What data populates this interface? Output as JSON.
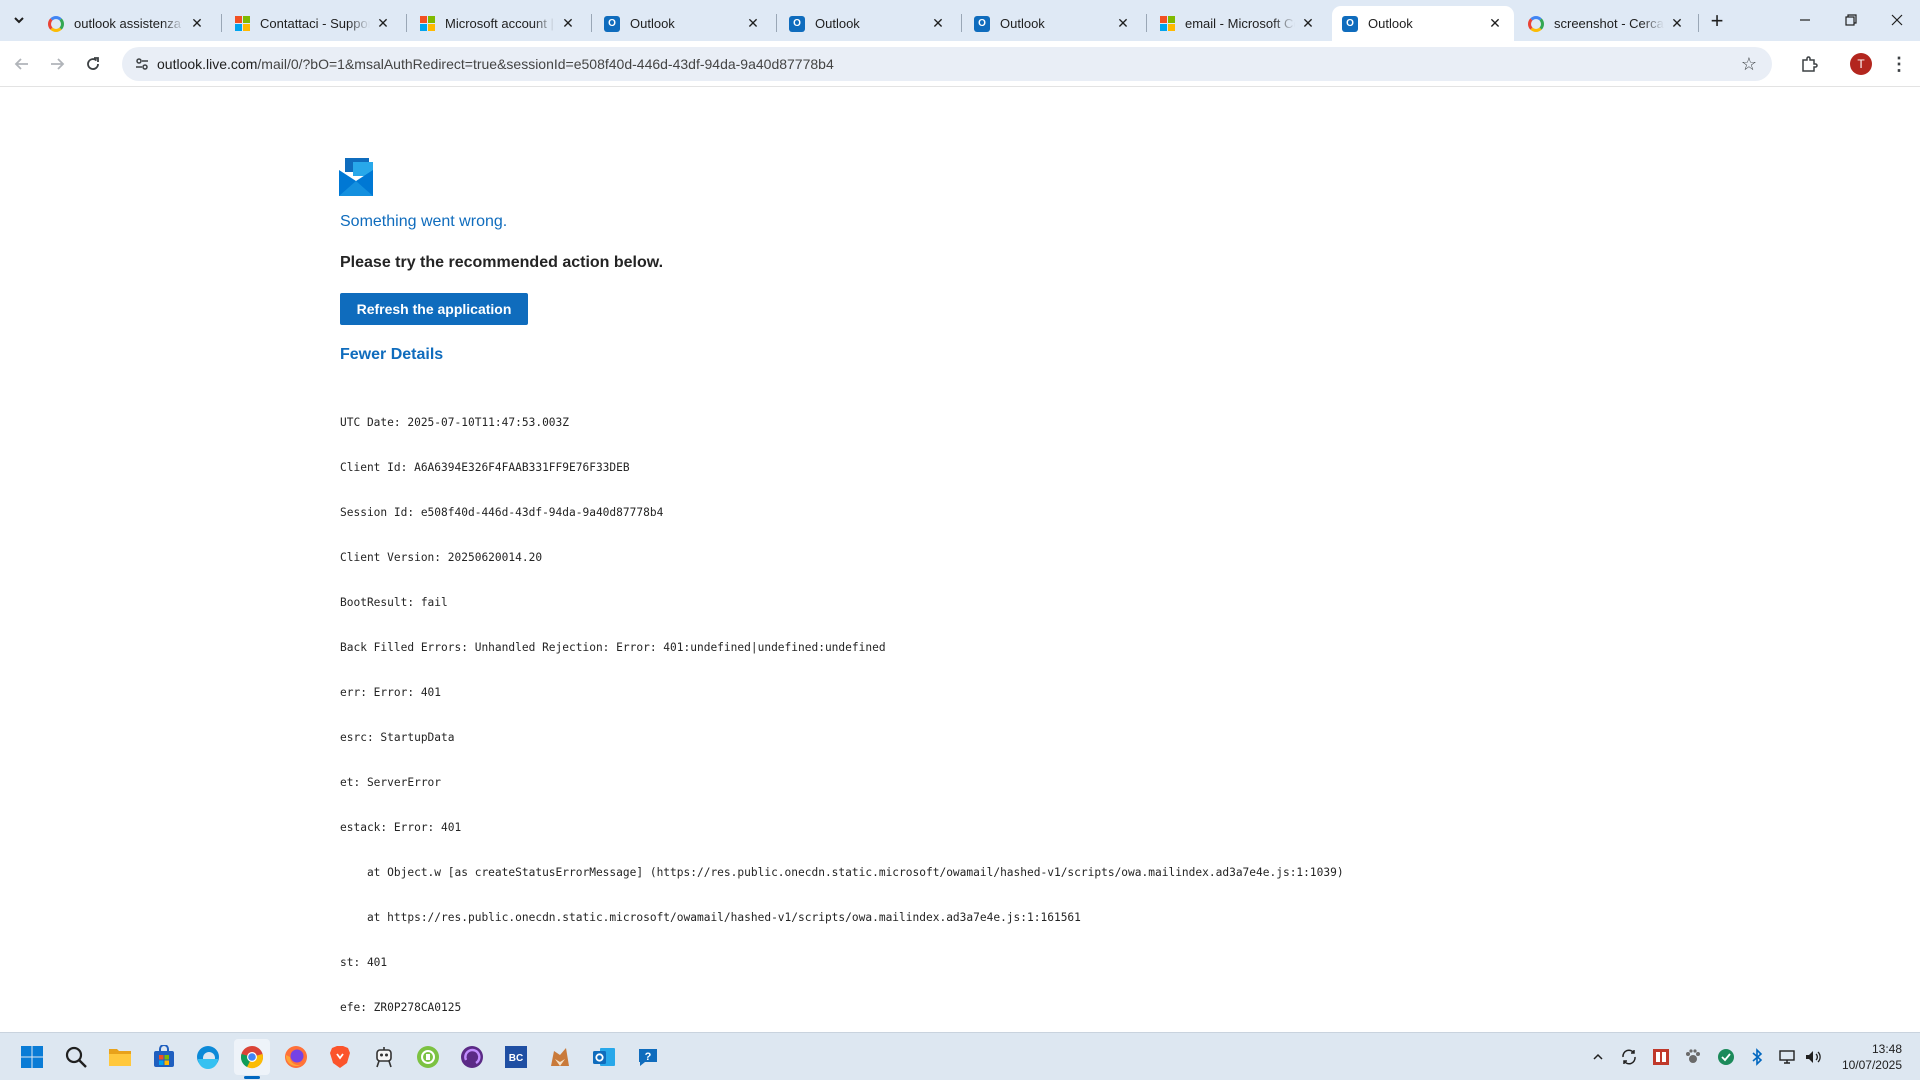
{
  "browser": {
    "tabs": [
      {
        "title": "outlook assistenza tel",
        "favicon": "google-icon",
        "active": false
      },
      {
        "title": "Contattaci - Supporto",
        "favicon": "microsoft-icon",
        "active": false
      },
      {
        "title": "Microsoft account | H",
        "favicon": "microsoft-icon",
        "active": false
      },
      {
        "title": "Outlook",
        "favicon": "outlook-icon",
        "active": false
      },
      {
        "title": "Outlook",
        "favicon": "outlook-icon",
        "active": false
      },
      {
        "title": "Outlook",
        "favicon": "outlook-icon",
        "active": false
      },
      {
        "title": "email - Microsoft Cor",
        "favicon": "microsoft-icon",
        "active": false
      },
      {
        "title": "Outlook",
        "favicon": "outlook-icon",
        "active": true
      },
      {
        "title": "screenshot - Cerca co",
        "favicon": "google-icon",
        "active": false
      }
    ],
    "url_host": "outlook.live.com",
    "url_rest": "/mail/0/?bO=1&msalAuthRedirect=true&sessionId=e508f40d-446d-43df-94da-9a40d87778b4",
    "profile_initial": "T"
  },
  "page": {
    "error_title": "Something went wrong.",
    "error_subtitle": "Please try the recommended action below.",
    "refresh_button": "Refresh the application",
    "details_toggle": "Fewer Details",
    "details_lines": [
      "UTC Date: 2025-07-10T11:47:53.003Z",
      "Client Id: A6A6394E326F4FAAB331FF9E76F33DEB",
      "Session Id: e508f40d-446d-43df-94da-9a40d87778b4",
      "Client Version: 20250620014.20",
      "BootResult: fail",
      "Back Filled Errors: Unhandled Rejection: Error: 401:undefined|undefined:undefined",
      "err: Error: 401",
      "esrc: StartupData",
      "et: ServerError",
      "estack: Error: 401",
      "    at Object.w [as createStatusErrorMessage] (https://res.public.onecdn.static.microsoft/owamail/hashed-v1/scripts/owa.mailindex.ad3a7e4e.js:1:1039)",
      "    at https://res.public.onecdn.static.microsoft/owamail/hashed-v1/scripts/owa.mailindex.ad3a7e4e.js:1:161561",
      "st: 401",
      "efe: ZR0P278CA0125"
    ]
  },
  "taskbar": {
    "apps": [
      "windows-start-icon",
      "search-icon",
      "file-explorer-icon",
      "microsoft-store-icon",
      "edge-icon",
      "chrome-icon",
      "firefox-icon",
      "brave-icon",
      "robot-icon",
      "green-app-icon",
      "purple-app-icon",
      "bc-app-icon",
      "fox-app-icon",
      "outlook-icon",
      "help-icon"
    ],
    "time": "13:48",
    "date": "10/07/2025"
  },
  "colors": {
    "accent": "#0f6cbd",
    "tabstrip": "#dfe9f5",
    "taskbar": "#dde7f1"
  }
}
